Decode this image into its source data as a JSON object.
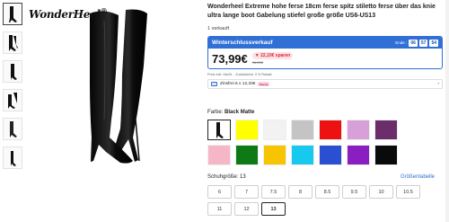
{
  "logo": {
    "text": "WonderHeel",
    "mark": "®"
  },
  "product": {
    "title": "Wonderheel Extreme hohe ferse 18cm ferse spitz stiletto ferse über das knie ultra lange boot Gabelung stiefel große größe US6-US13",
    "sold": "1 verkauft"
  },
  "deal": {
    "title": "Winterschlussverkauf",
    "ends_label": "Ende :",
    "countdown": [
      "06",
      "57",
      "54"
    ],
    "price": "73,99€",
    "savings": "▼ 22,10€ sparen",
    "old_price": "96,09€"
  },
  "vat_note": "Preis inkl. MwSt. , Zusätzlicher 3 % Rabatt",
  "installment": {
    "text": "Zinsfrei 6 x 12,33€",
    "badge": "Klarna",
    "chevron": "›"
  },
  "color": {
    "label": "Farbe:",
    "value": "Black Matte"
  },
  "swatch_colors": [
    "#ffffff",
    "#ffff00",
    "#f2f2f2",
    "#c4c4c4",
    "#ee1111",
    "#d8a0d8",
    "#6b2e6b",
    "#f5b6c8",
    "#0e7a16",
    "#f6c400",
    "#17c9ee",
    "#2b4fd1",
    "#8a1ec0",
    "#0a0a0a"
  ],
  "size": {
    "label": "Schuhgröße: 13",
    "guide": "Größentabelle",
    "options": [
      "6",
      "7",
      "7.5",
      "8",
      "8.5",
      "9.5",
      "10",
      "10.5",
      "11",
      "12",
      "13"
    ],
    "selected": "13"
  }
}
